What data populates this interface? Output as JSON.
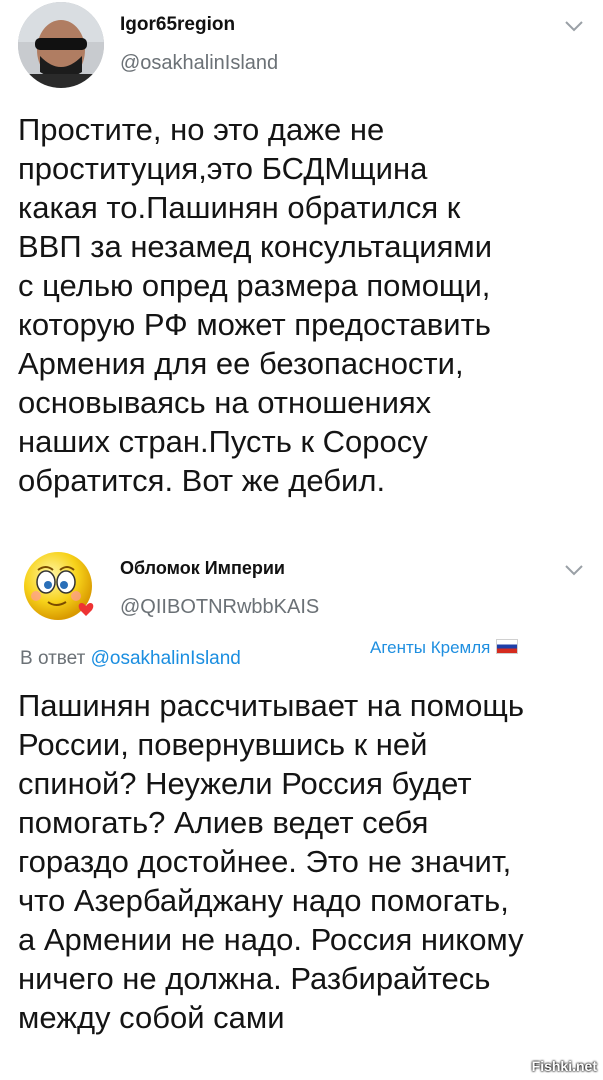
{
  "tweet1": {
    "author_name": "Igor65region",
    "author_handle": "@osakhalinIsland",
    "lines": [
      "Простите, но это даже не",
      "проституция,это БСДМщина",
      "какая то.Пашинян обратился к",
      "ВВП за незамед консультациями",
      "с целью опред  размера помощи,",
      "которую РФ может предоставить",
      "Армения для  ее безопасности,",
      "основываясь на отношениях",
      "наших стран.Пусть к Соросу",
      "обратится. Вот же дебил."
    ]
  },
  "tweet2": {
    "author_name": "Обломок Империи",
    "author_handle": "@QIIBOTNRwbbKAIS",
    "reply_prefix": "В ответ",
    "reply_mention": "@osakhalinIsland",
    "badge_text": "Агенты Кремля",
    "lines": [
      "Пашинян рассчитывает на помощь",
      "России, повернувшись к ней",
      "спиной? Неужели Россия будет",
      "помогать? Алиев ведет себя",
      "гораздо достойнее. Это не значит,",
      "что Азербайджану надо помогать,",
      "а Армении не надо. Россия никому",
      "ничего не должна. Разбирайтесь",
      "между собой сами"
    ]
  },
  "watermark": "Fishki.net",
  "icons": {
    "menu": "chevron-down-icon",
    "flag": "russian-flag-icon"
  }
}
